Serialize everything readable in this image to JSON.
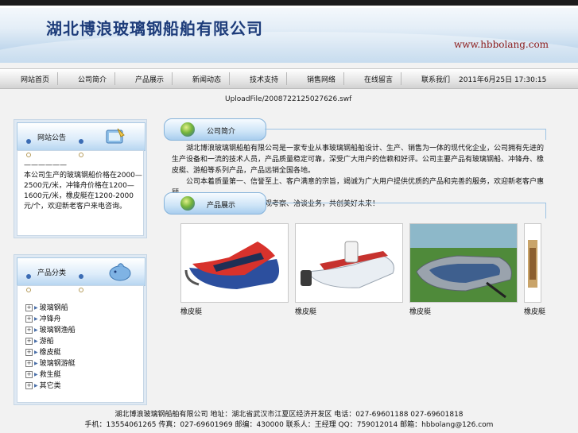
{
  "header": {
    "company_name": "湖北博浪玻璃钢船舶有限公司",
    "site_url": "www.hbbolang.com"
  },
  "nav": {
    "items": [
      "网站首页",
      "公司简介",
      "产品展示",
      "新闻动态",
      "技术支持",
      "销售网络",
      "在线留言",
      "联系我们"
    ],
    "datetime": "2011年6月25日 17:30:15"
  },
  "flash_path": "UploadFile/2008722125027626.swf",
  "sidebar": {
    "notice": {
      "title": "网站公告",
      "text": "——————\n本公司生产的玻璃钢船价格在2000—2500元/米，冲锋舟价格在1200—1600元/米，橡皮艇在1200-2000元/个，欢迎新老客户来电咨询。"
    },
    "categories": {
      "title": "产品分类",
      "items": [
        "玻璃钢船",
        "冲锋舟",
        "玻璃钢渔船",
        "游船",
        "橡皮艇",
        "玻璃钢游艇",
        "救生艇",
        "其它类"
      ]
    }
  },
  "main": {
    "intro": {
      "title": "公司简介",
      "paragraphs": [
        "　　湖北博浪玻璃钢船舶有限公司是一家专业从事玻璃钢船舶设计、生产、销售为一体的现代化企业，公司拥有先进的生产设备和一流的技术人员，产品质量稳定可靠，深受广大用户的信赖和好评。公司主要产品有玻璃钢船、冲锋舟、橡皮艇、游船等系列产品，产品远销全国各地。",
        "　　公司本着质量第一、信誉至上、客户满意的宗旨，竭诚为广大用户提供优质的产品和完善的服务，欢迎新老客户惠顾。",
        "　　热忱欢迎各界朋友前来参观考察、洽谈业务，共创美好未来！"
      ]
    },
    "products": {
      "title": "产品展示",
      "items": [
        {
          "name": "橡皮艇"
        },
        {
          "name": "橡皮艇"
        },
        {
          "name": "橡皮艇"
        },
        {
          "name": "橡皮艇"
        }
      ]
    }
  },
  "footer": {
    "line1": "湖北博浪玻璃钢船舶有限公司 地址：湖北省武汉市江夏区经济开发区 电话：027-69601188 027-69601818",
    "line2": "手机：13554061265 传真：027-69601969 邮编：430000 联系人：王经理 QQ：759012014 邮箱：hbbolang@126.com"
  },
  "colors": {
    "banner_title": "#1d3c7a",
    "url": "#8b1a1a",
    "panel_border": "#86b3da"
  }
}
